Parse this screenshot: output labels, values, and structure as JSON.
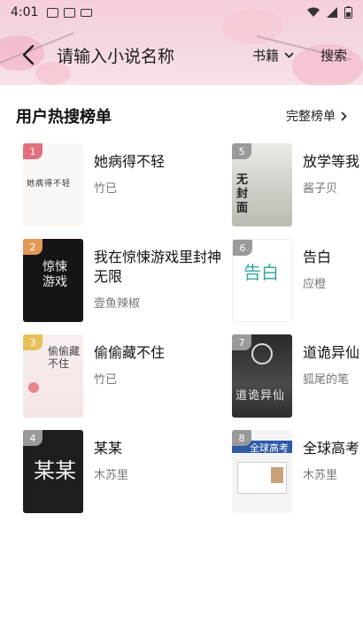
{
  "status": {
    "time": "4:01"
  },
  "toolbar": {
    "search_placeholder": "请输入小说名称",
    "category": "书籍",
    "search_button": "搜索"
  },
  "section": {
    "title": "用户热搜榜单",
    "full_list": "完整榜单"
  },
  "books": [
    {
      "rank": "1",
      "title": "她病得不轻",
      "author": "竹已",
      "rank_color": "#e0707d",
      "cover_text": "她病得不轻"
    },
    {
      "rank": "5",
      "title": "放学等我",
      "author": "酱子贝",
      "rank_color": "#9a9a9a",
      "cover_text": "无封面"
    },
    {
      "rank": "2",
      "title": "我在惊悚游戏里封神无限",
      "author": "壹鱼辣椒",
      "rank_color": "#e29956",
      "cover_text": "惊悚游戏"
    },
    {
      "rank": "6",
      "title": "告白",
      "author": "应橙",
      "rank_color": "#9a9a9a",
      "cover_text": "告白"
    },
    {
      "rank": "3",
      "title": "偷偷藏不住",
      "author": "竹已",
      "rank_color": "#e8c05a",
      "cover_text": "偷偷藏不住"
    },
    {
      "rank": "7",
      "title": "道诡异仙",
      "author": "狐尾的笔",
      "rank_color": "#9a9a9a",
      "cover_text": "道诡异仙"
    },
    {
      "rank": "4",
      "title": "某某",
      "author": "木苏里",
      "rank_color": "#9a9a9a",
      "cover_text": "某某"
    },
    {
      "rank": "8",
      "title": "全球高考",
      "author": "木苏里",
      "rank_color": "#9a9a9a",
      "cover_text": "全球高考"
    }
  ]
}
